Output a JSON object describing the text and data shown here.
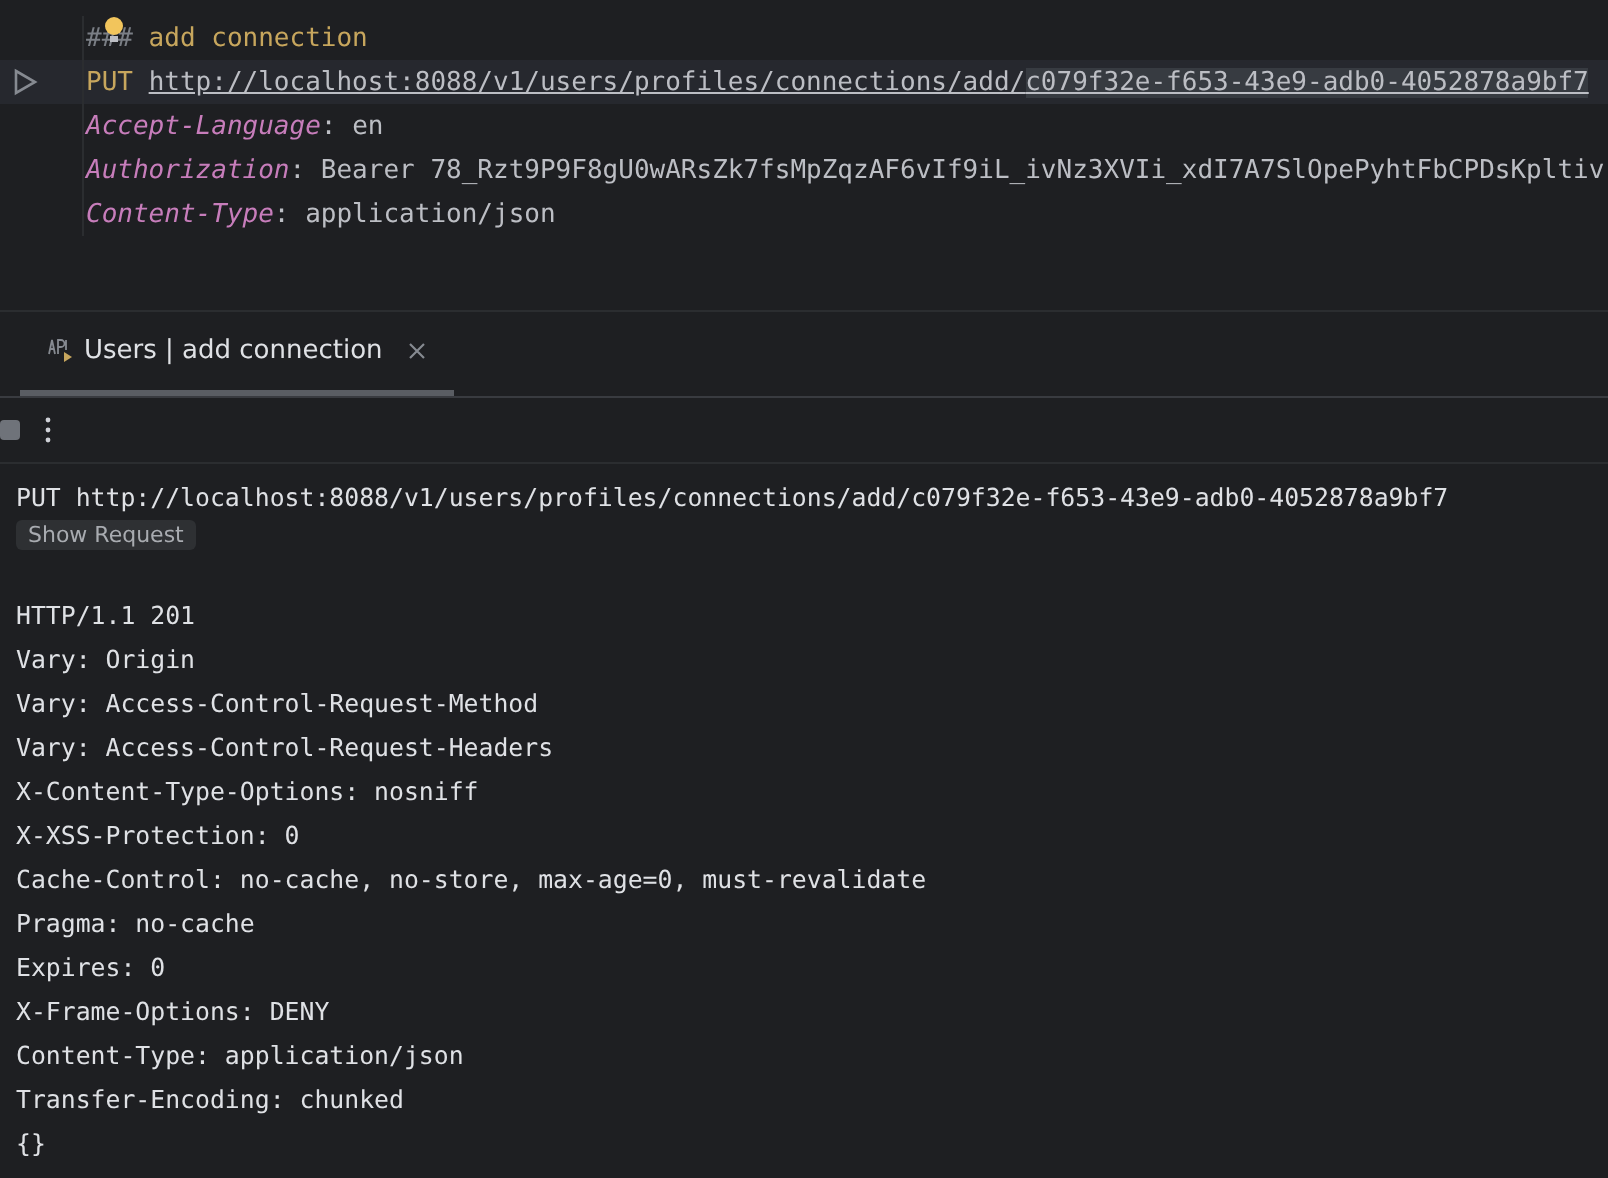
{
  "editor": {
    "comment": "### add connection",
    "request": {
      "method": "PUT",
      "url": "http://localhost:8088/v1/users/profiles/connections/add/",
      "url_selected_part": "c079f32e-f653-43e9-adb0-4052878a9bf7"
    },
    "headers": [
      {
        "name": "Accept-Language",
        "separator": ":",
        "value": "en"
      },
      {
        "name": "Authorization",
        "separator": ":",
        "value": "Bearer 78_Rzt9P9F8gU0wARsZk7fsMpZqzAF6vIf9iL_ivNz3XVIi_xdI7A7SlOpePyhtFbCPDsKpltiv"
      },
      {
        "name": "Content-Type",
        "separator": ":",
        "value": "application/json"
      }
    ]
  },
  "tabs": [
    {
      "label": "Users | add connection",
      "selected": true
    }
  ],
  "response": {
    "request_line": "PUT http://localhost:8088/v1/users/profiles/connections/add/c079f32e-f653-43e9-adb0-4052878a9bf7",
    "show_request_button": "Show Request",
    "lines": [
      "HTTP/1.1 201",
      "Vary: Origin",
      "Vary: Access-Control-Request-Method",
      "Vary: Access-Control-Request-Headers",
      "X-Content-Type-Options: nosniff",
      "X-XSS-Protection: 0",
      "Cache-Control: no-cache, no-store, max-age=0, must-revalidate",
      "Pragma: no-cache",
      "Expires: 0",
      "X-Frame-Options: DENY",
      "Content-Type: application/json",
      "Transfer-Encoding: chunked"
    ],
    "body": "{}"
  }
}
